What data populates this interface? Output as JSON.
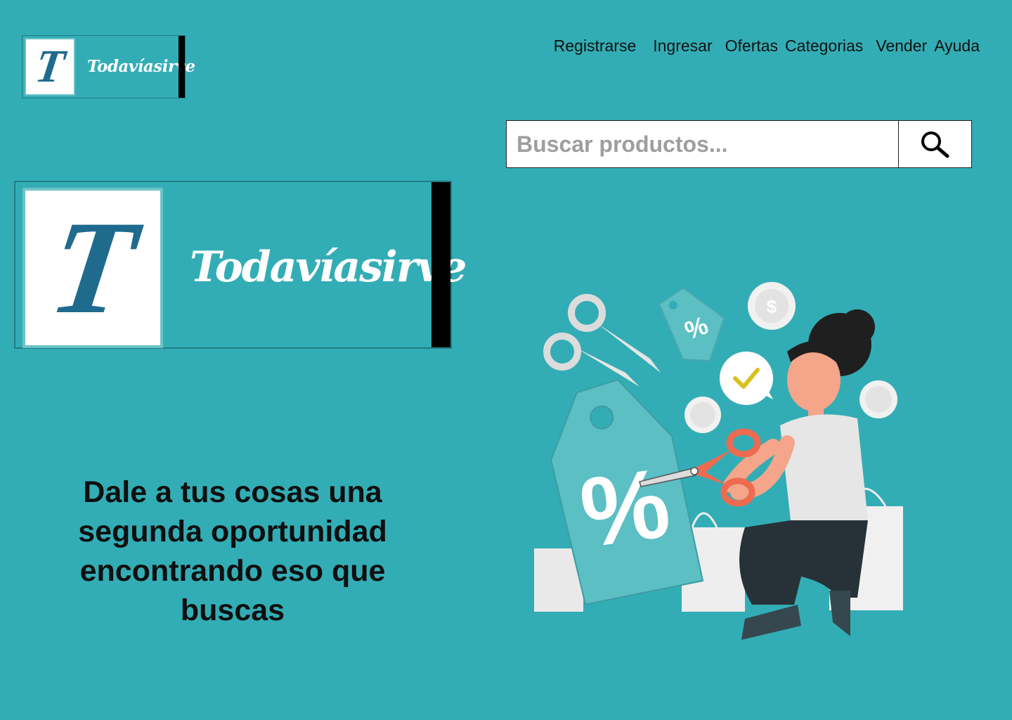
{
  "theme": {
    "background": "#33adb5",
    "tag_color": "#5bbfc4",
    "scissor_color": "#ee6b50"
  },
  "header": {
    "logo": {
      "letter": "T",
      "wordmark": "Todavíasirve",
      "icon": "logo-t-icon"
    },
    "nav": [
      {
        "label": "Registrarse",
        "gap_after": 24
      },
      {
        "label": "Ingresar",
        "gap_after": 18
      },
      {
        "label": "Ofertas",
        "gap_after": 10
      },
      {
        "label": "Categorias",
        "gap_after": 18
      },
      {
        "label": "Vender",
        "gap_after": 10
      },
      {
        "label": "Ayuda",
        "gap_after": 0
      }
    ]
  },
  "search": {
    "placeholder": "Buscar productos...",
    "value": "",
    "icon": "search-icon"
  },
  "hero": {
    "logo": {
      "letter": "T",
      "wordmark": "Todavíasirve"
    },
    "headline": "Dale a  tus cosas una\nsegunda oportunidad\nencontrando eso que\nbuscas",
    "illustration": {
      "tag_small": "%",
      "tag_big": "%",
      "coin_symbol": "$",
      "check": "✔"
    }
  }
}
